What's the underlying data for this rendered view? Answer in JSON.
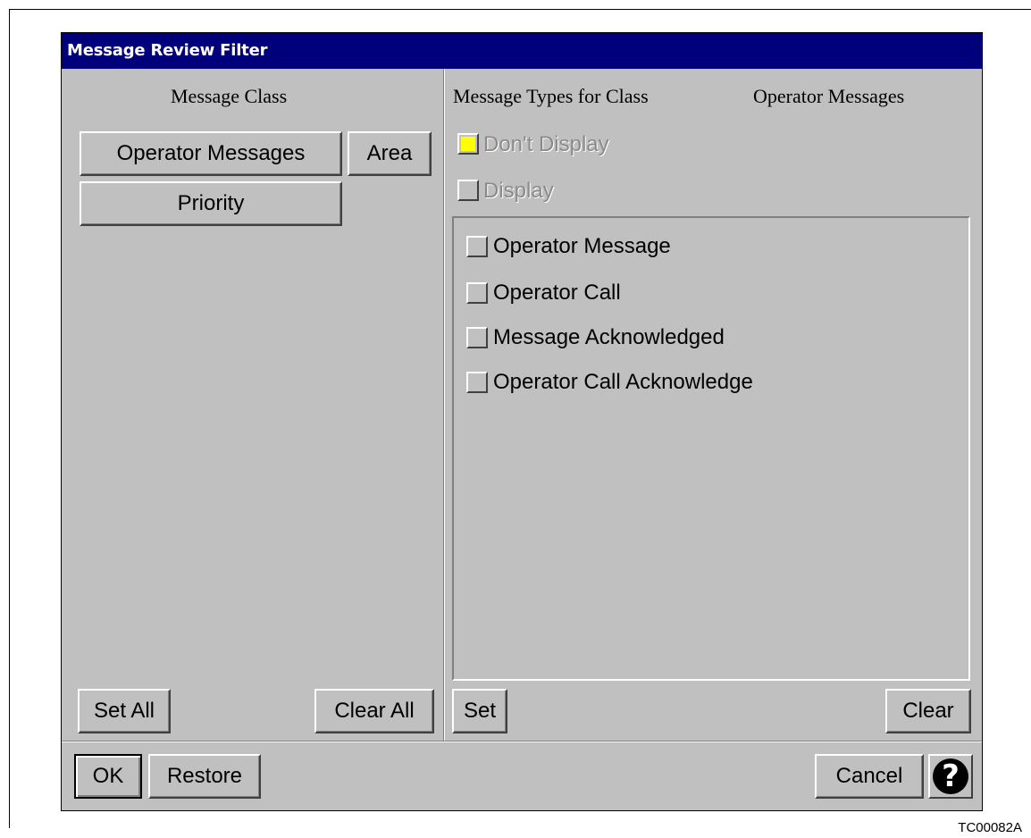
{
  "window": {
    "title": "Message Review Filter"
  },
  "left": {
    "heading": "Message Class",
    "class_buttons": [
      "Operator Messages",
      "Area",
      "Priority"
    ],
    "set_all_label": "Set All",
    "clear_all_label": "Clear All"
  },
  "right": {
    "heading": "Message Types for Class",
    "current_class": "Operator Messages",
    "dont_display_label": "Don't Display",
    "display_label": "Display",
    "dont_display_checked_color": "#ffff00",
    "types": [
      "Operator Message",
      "Operator Call",
      "Message Acknowledged",
      "Operator Call Acknowledge"
    ],
    "set_label": "Set",
    "clear_label": "Clear"
  },
  "footer": {
    "ok_label": "OK",
    "restore_label": "Restore",
    "cancel_label": "Cancel",
    "help_symbol": "?"
  },
  "figure_id": "TC00082A",
  "colors": {
    "titlebar": "#00007b",
    "face": "#c0c0c0"
  }
}
